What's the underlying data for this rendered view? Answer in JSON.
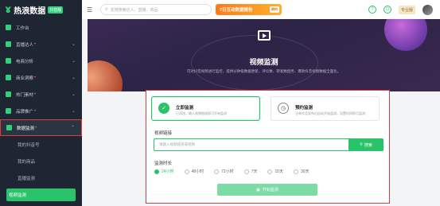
{
  "app": {
    "logo_text": "热浪数据",
    "version": "抖音版"
  },
  "sidebar": {
    "items": [
      {
        "label": "工作台",
        "dot": false,
        "chev": false
      },
      {
        "label": "直播达人",
        "dot": true,
        "chev": true
      },
      {
        "label": "电商分析",
        "dot": false,
        "chev": true
      },
      {
        "label": "商业洞察",
        "dot": true,
        "chev": true
      },
      {
        "label": "热门素材",
        "dot": true,
        "chev": true
      },
      {
        "label": "品牌推广",
        "dot": true,
        "chev": true
      },
      {
        "label": "数据监测",
        "dot": true,
        "chev": true
      }
    ],
    "sub_items": [
      "我的抖音号",
      "我的商品",
      "直播监测",
      "视频监测"
    ]
  },
  "topbar": {
    "search_placeholder": "支持搜索达人、直播、商品",
    "promo_label": "7日互动数据报告",
    "promo_tag": "限时",
    "member_badge": "专业版",
    "user_name": ""
  },
  "banner": {
    "title": "视频监测",
    "subtitle": "可对抖音视频进行监控，提供分钟级数据更新，评论数、转发数趋势、爆款抖音视频数据全面化。"
  },
  "panel": {
    "card_immediate": {
      "title": "立即监测",
      "desc": "已添加，输入视频链接即可开始监测"
    },
    "card_scheduled": {
      "title": "预约监测",
      "desc": "当有作品发布后自动开始监测，设置时间即可监测"
    },
    "url_label": "视频链接",
    "url_placeholder": "请输入视频链接或视频",
    "search_button": "搜索",
    "duration_label": "监测时长",
    "durations": [
      "24小时",
      "48小时",
      "72小时",
      "7天",
      "15天",
      "30天"
    ],
    "selected_duration": "24小时",
    "start_button": "开始监测"
  },
  "colors": {
    "accent": "#29c36a",
    "highlight": "#e23b3b",
    "sidebar_bg": "#1e2633"
  }
}
